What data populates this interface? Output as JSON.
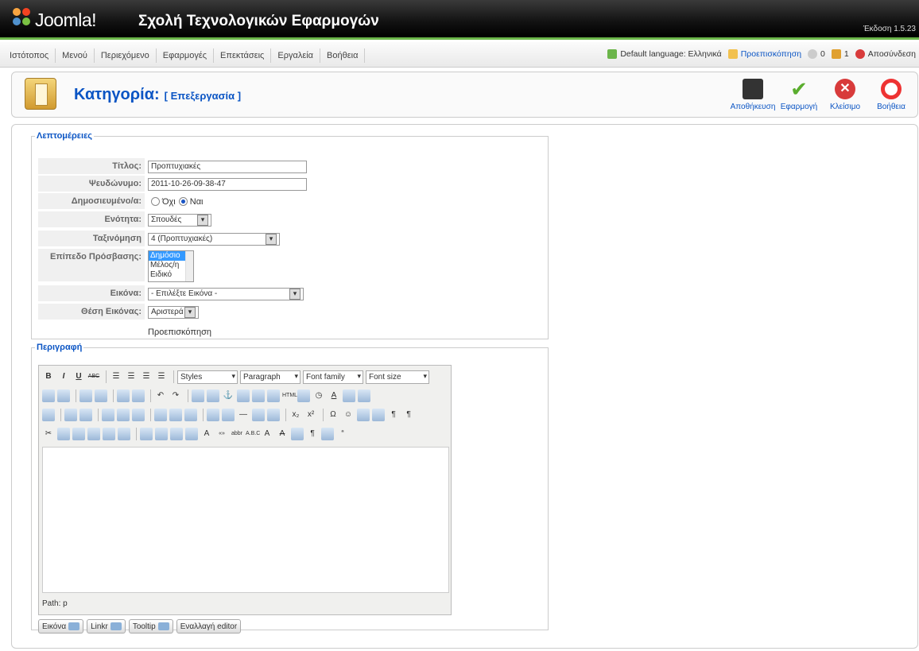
{
  "header": {
    "brand": "Joomla!",
    "site_name": "Σχολή Τεχνολογικών Εφαρμογών",
    "version": "Έκδοση 1.5.23"
  },
  "menu": {
    "items": [
      "Ιστότοπος",
      "Μενού",
      "Περιεχόμενο",
      "Εφαρμογές",
      "Επεκτάσεις",
      "Εργαλεία",
      "Βοήθεια"
    ]
  },
  "status": {
    "language": "Default language: Ελληνικά",
    "preview": "Προεπισκόπηση",
    "messages": "0",
    "users": "1",
    "logout": "Αποσύνδεση"
  },
  "title": {
    "main": "Κατηγορία:",
    "sub": "[ Επεξεργασία ]"
  },
  "toolbar": {
    "save": "Αποθήκευση",
    "apply": "Εφαρμογή",
    "close": "Κλείσιμο",
    "help": "Βοήθεια"
  },
  "details": {
    "legend": "Λεπτομέρειες",
    "title_label": "Τίτλος:",
    "title_value": "Προπτυχιακές",
    "alias_label": "Ψευδώνυμο:",
    "alias_value": "2011-10-26-09-38-47",
    "published_label": "Δημοσιευμένο/α:",
    "published_no": "Όχι",
    "published_yes": "Ναι",
    "section_label": "Ενότητα:",
    "section_value": "Σπουδές",
    "order_label": "Ταξινόμηση Κατηγοριών:",
    "order_value": "4 (Προπτυχιακές)",
    "access_label": "Επίπεδο Πρόσβασης:",
    "access_options": [
      "Δημόσιο",
      "Μέλος/η",
      "Ειδικό"
    ],
    "image_label": "Εικόνα:",
    "image_value": "- Επιλέξτε Εικόνα -",
    "imgpos_label": "Θέση Εικόνας:",
    "imgpos_value": "Αριστερά",
    "preview": "Προεπισκόπηση"
  },
  "description": {
    "legend": "Περιγραφή",
    "styles": "Styles",
    "paragraph": "Paragraph",
    "font_family": "Font family",
    "font_size": "Font size",
    "path": "Path: p",
    "buttons": [
      "Εικόνα",
      "Linkr",
      "Tooltip",
      "Εναλλαγή editor"
    ]
  }
}
